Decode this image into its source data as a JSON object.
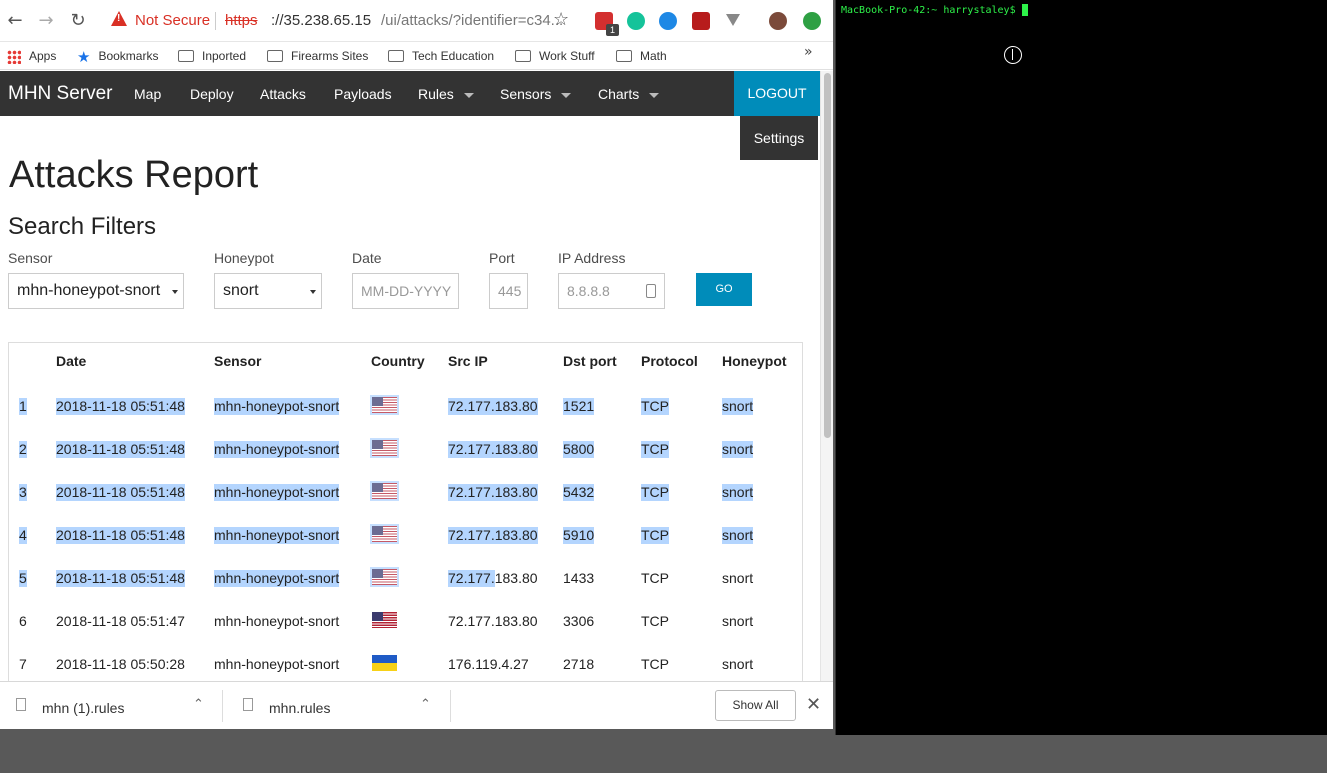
{
  "browser": {
    "security": "Not Secure",
    "url_scheme": "https",
    "url_host": "://35.238.65.15",
    "url_path": "/ui/attacks/?identifier=c34...",
    "ext_badge": "1"
  },
  "bookmarks": [
    {
      "label": "Apps",
      "icon": "apps-grid-icon"
    },
    {
      "label": "Bookmarks",
      "icon": "star-icon"
    },
    {
      "label": "Inported",
      "icon": "folder-icon"
    },
    {
      "label": "Firearms Sites",
      "icon": "folder-icon"
    },
    {
      "label": "Tech Education",
      "icon": "folder-icon"
    },
    {
      "label": "Work Stuff",
      "icon": "folder-icon"
    },
    {
      "label": "Math",
      "icon": "folder-icon"
    }
  ],
  "nav": {
    "brand": "MHN Server",
    "items": [
      "Map",
      "Deploy",
      "Attacks",
      "Payloads",
      "Rules",
      "Sensors",
      "Charts"
    ],
    "logout": "LOGOUT",
    "settings": "Settings"
  },
  "page": {
    "title": "Attacks Report",
    "filters_title": "Search Filters"
  },
  "filters": {
    "sensor_label": "Sensor",
    "sensor_value": "mhn-honeypot-snort",
    "honeypot_label": "Honeypot",
    "honeypot_value": "snort",
    "date_label": "Date",
    "date_placeholder": "MM-DD-YYYY",
    "port_label": "Port",
    "port_placeholder": "445",
    "ip_label": "IP Address",
    "ip_placeholder": "8.8.8.8",
    "go": "GO"
  },
  "table": {
    "headers": [
      "Date",
      "Sensor",
      "Country",
      "Src IP",
      "Dst port",
      "Protocol",
      "Honeypot"
    ],
    "rows": [
      {
        "n": "1",
        "date": "2018-11-18 05:51:48",
        "sensor": "mhn-honeypot-snort",
        "flag": "us",
        "src": "72.177.183.80",
        "port": "1521",
        "proto": "TCP",
        "hp": "snort"
      },
      {
        "n": "2",
        "date": "2018-11-18 05:51:48",
        "sensor": "mhn-honeypot-snort",
        "flag": "us",
        "src": "72.177.183.80",
        "port": "5800",
        "proto": "TCP",
        "hp": "snort"
      },
      {
        "n": "3",
        "date": "2018-11-18 05:51:48",
        "sensor": "mhn-honeypot-snort",
        "flag": "us",
        "src": "72.177.183.80",
        "port": "5432",
        "proto": "TCP",
        "hp": "snort"
      },
      {
        "n": "4",
        "date": "2018-11-18 05:51:48",
        "sensor": "mhn-honeypot-snort",
        "flag": "us",
        "src": "72.177.183.80",
        "port": "5910",
        "proto": "TCP",
        "hp": "snort"
      },
      {
        "n": "5",
        "date": "2018-11-18 05:51:48",
        "sensor": "mhn-honeypot-snort",
        "flag": "us",
        "src": "72.177.183.80",
        "port": "1433",
        "proto": "TCP",
        "hp": "snort"
      },
      {
        "n": "6",
        "date": "2018-11-18 05:51:47",
        "sensor": "mhn-honeypot-snort",
        "flag": "us",
        "src": "72.177.183.80",
        "port": "3306",
        "proto": "TCP",
        "hp": "snort"
      },
      {
        "n": "7",
        "date": "2018-11-18 05:50:28",
        "sensor": "mhn-honeypot-snort",
        "flag": "ua",
        "src": "176.119.4.27",
        "port": "2718",
        "proto": "TCP",
        "hp": "snort"
      }
    ]
  },
  "downloads": {
    "items": [
      "mhn (1).rules",
      "mhn.rules"
    ],
    "show_all": "Show All"
  },
  "terminal": {
    "prompt": "MacBook-Pro-42:~ harrystaley$"
  }
}
